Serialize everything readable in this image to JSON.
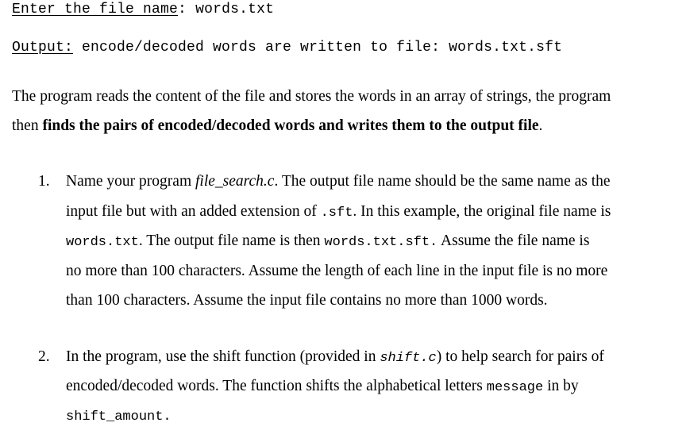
{
  "console": {
    "enter_prompt_label": "Enter the file name",
    "enter_prompt_colon": ": ",
    "enter_value": "words.txt",
    "output_label": "Output:",
    "output_text": " encode/decoded words are written to file: words.txt.sft"
  },
  "intro": {
    "line1": "The program reads the content of the file and stores the words in an array of strings, the program",
    "line2_plain": "then ",
    "line2_bold": "finds the pairs of encoded/decoded words and writes them to the output file",
    "line2_end": "."
  },
  "items": [
    {
      "number": "1.",
      "l1_a": "Name your program ",
      "l1_italic": "file_search.c",
      "l1_b": ". The output file name should be the same name as the",
      "l2_a": "input file but with an added extension of ",
      "l2_code": ".sft",
      "l2_b": ".  In this example, the original file name is",
      "l3_code1": "words.txt",
      "l3_a": ". The output file name is then ",
      "l3_code2": "words.txt.sft.",
      "l3_b": " Assume the file name is",
      "l4": "no more than 100 characters. Assume the length of each line in the input file is no more",
      "l5": "than 100 characters. Assume the input file contains no more than 1000 words."
    },
    {
      "number": "2.",
      "l1_a": "In the program, use the shift function  (provided in ",
      "l1_code": "shift.c",
      "l1_b": ")  to help search for pairs of",
      "l2_a": "encoded/decoded words. The function shifts the alphabetical letters ",
      "l2_code": "message",
      "l2_b": " in by",
      "l3_code": "shift_amount",
      "l3_b": "."
    }
  ]
}
